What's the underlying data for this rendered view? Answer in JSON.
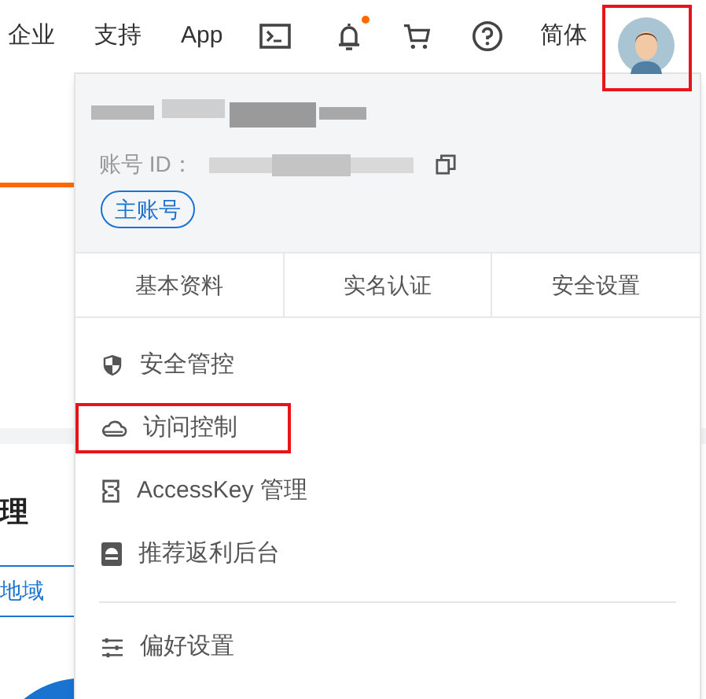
{
  "top_nav": {
    "links": [
      "企业",
      "支持",
      "App"
    ],
    "notifications": {
      "unread": true
    },
    "language": "简体",
    "avatar": {
      "highlighted": true
    }
  },
  "page": {
    "heading": "理",
    "tab": "地域"
  },
  "account_menu": {
    "account_id_label": "账号 ID：",
    "account_badge": "主账号",
    "tabs": [
      "基本资料",
      "实名认证",
      "安全设置"
    ],
    "items": [
      {
        "label": "安全管控",
        "highlighted": false
      },
      {
        "label": "访问控制",
        "highlighted": true
      },
      {
        "label": "AccessKey 管理",
        "highlighted": false
      },
      {
        "label": "推荐返利后台",
        "highlighted": false
      }
    ],
    "footer_items": [
      {
        "label": "偏好设置"
      }
    ]
  }
}
